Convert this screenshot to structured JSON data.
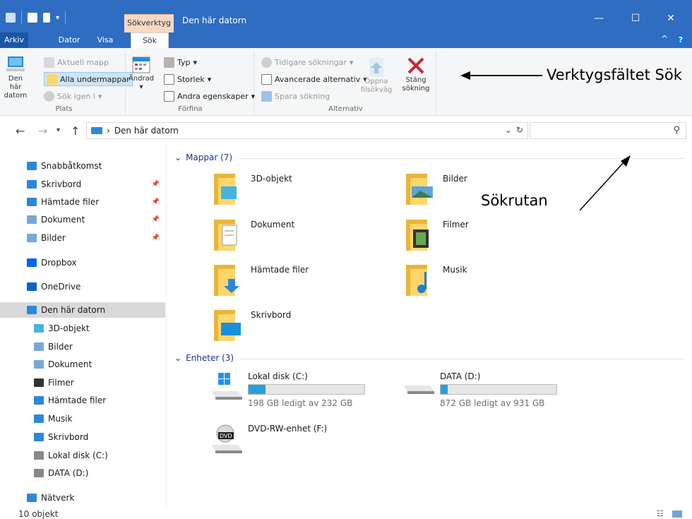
{
  "window": {
    "title": "Den här datorn",
    "context_tab": "Sökverktyg",
    "controls": [
      "—",
      "☐",
      "✕"
    ]
  },
  "tabs": [
    {
      "label": "Arkiv"
    },
    {
      "label": "Dator"
    },
    {
      "label": "Visa"
    },
    {
      "label": "Sök"
    }
  ],
  "ribbon": {
    "plats": {
      "label": "Plats",
      "den_har_datorn": "Den här datorn",
      "aktuell_mapp": "Aktuell mapp",
      "alla_undermappar": "Alla undermappar",
      "sok_igen_i": "Sök igen i"
    },
    "forfina": {
      "label": "Förfina",
      "andrad": "Ändrad",
      "typ": "Typ",
      "storlek": "Storlek",
      "andra_egenskaper": "Andra egenskaper"
    },
    "alternativ": {
      "label": "Alternativ",
      "tidigare_sokningar": "Tidigare sökningar",
      "avancerade_alternativ": "Avancerade alternativ",
      "spara_sokning": "Spara sökning",
      "oppna_filsokvag": "Öppna filsökväg",
      "stang_sokning": "Stäng sökning"
    }
  },
  "annotations": {
    "toolbar": "Verktygsfältet Sök",
    "searchbox": "Sökrutan"
  },
  "address": {
    "path": "Den här datorn",
    "search_placeholder": ""
  },
  "sidebar": {
    "items": [
      {
        "label": "Snabbåtkomst",
        "icon": "star-icon",
        "color": "#2b88d8"
      },
      {
        "label": "Skrivbord",
        "icon": "desktop-folder-icon",
        "color": "#2b88d8",
        "pinned": true
      },
      {
        "label": "Hämtade filer",
        "icon": "downloads-folder-icon",
        "color": "#2b88d8",
        "pinned": true
      },
      {
        "label": "Dokument",
        "icon": "documents-folder-icon",
        "color": "#7aa7d8",
        "pinned": true
      },
      {
        "label": "Bilder",
        "icon": "pictures-folder-icon",
        "color": "#7aa7d8",
        "pinned": true
      },
      {
        "label": "Dropbox",
        "icon": "dropbox-icon",
        "color": "#0061fe"
      },
      {
        "label": "OneDrive",
        "icon": "onedrive-icon",
        "color": "#0a64c8"
      },
      {
        "label": "Den här datorn",
        "icon": "computer-icon",
        "color": "#2b88d8"
      },
      {
        "label": "3D-objekt",
        "icon": "3d-objects-icon",
        "color": "#43b5e0"
      },
      {
        "label": "Bilder",
        "icon": "pictures-folder-icon",
        "color": "#7aa7d8"
      },
      {
        "label": "Dokument",
        "icon": "documents-folder-icon",
        "color": "#7aa7d8"
      },
      {
        "label": "Filmer",
        "icon": "videos-folder-icon",
        "color": "#333333"
      },
      {
        "label": "Hämtade filer",
        "icon": "downloads-folder-icon",
        "color": "#2b88d8"
      },
      {
        "label": "Musik",
        "icon": "music-folder-icon",
        "color": "#2b88d8"
      },
      {
        "label": "Skrivbord",
        "icon": "desktop-folder-icon",
        "color": "#2b88d8"
      },
      {
        "label": "Lokal disk (C:)",
        "icon": "local-disk-icon",
        "color": "#888888"
      },
      {
        "label": "DATA (D:)",
        "icon": "data-drive-icon",
        "color": "#888888"
      },
      {
        "label": "Nätverk",
        "icon": "network-icon",
        "color": "#2b88d8"
      }
    ]
  },
  "content": {
    "folders_header": "Mappar (7)",
    "devices_header": "Enheter (3)",
    "folders": [
      {
        "name": "3D-objekt",
        "icon": "3d-objects-icon"
      },
      {
        "name": "Bilder",
        "icon": "pictures-folder-icon"
      },
      {
        "name": "Dokument",
        "icon": "documents-folder-icon"
      },
      {
        "name": "Filmer",
        "icon": "videos-folder-icon"
      },
      {
        "name": "Hämtade filer",
        "icon": "downloads-folder-icon"
      },
      {
        "name": "Musik",
        "icon": "music-folder-icon"
      },
      {
        "name": "Skrivbord",
        "icon": "desktop-folder-icon"
      }
    ],
    "drives": [
      {
        "name": "Lokal disk (C:)",
        "info": "198 GB ledigt av 232 GB",
        "used_fraction": 0.147
      },
      {
        "name": "DATA (D:)",
        "info": "872 GB ledigt av 931 GB",
        "used_fraction": 0.063
      },
      {
        "name": "DVD-RW-enhet (F:)",
        "info": ""
      }
    ]
  },
  "status": {
    "count": "10 objekt"
  }
}
